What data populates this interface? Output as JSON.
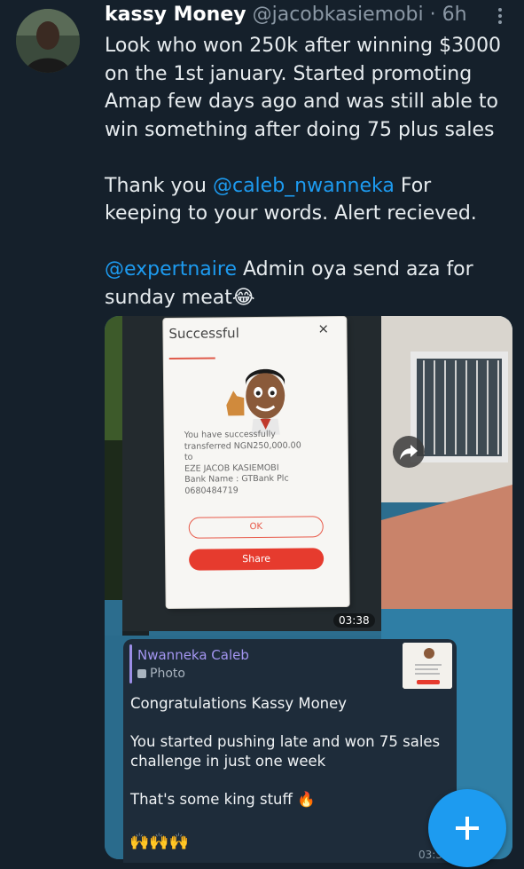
{
  "author": {
    "display_name": "kassy Money",
    "handle": "@jacobkasiemobi",
    "separator": "·",
    "time": "6h"
  },
  "tweet": {
    "paragraph1": "Look who won 250k after winning $3000 on the 1st january. Started promoting Amap few days ago and was still able to win something after doing 75 plus sales",
    "p2_before": "Thank you ",
    "p2_mention": "@caleb_nwanneka",
    "p2_after": " For keeping to your words. Alert recieved.",
    "p3_mention": "@expertnaire",
    "p3_after": " Admin oya send aza for sunday meat😂"
  },
  "media": {
    "photo_time": "03:38",
    "dialog": {
      "title": "Successful",
      "close": "×",
      "line1": "You have successfully",
      "line2": "transferred NGN250,000.00",
      "line3": "to",
      "line4": "EZE JACOB KASIEMOBI",
      "line5": "Bank Name : GTBank Plc",
      "line6": "0680484719",
      "ok_label": "OK",
      "share_label": "Share"
    },
    "message": {
      "reply_author": "Nwanneka Caleb",
      "reply_type": "Photo",
      "para1": "Congratulations Kassy Money",
      "para2": "You started pushing late and won 75 sales challenge in just one week",
      "para3": "That's some king stuff 🔥",
      "emoji_row": "🙌🙌🙌",
      "time": "03:3"
    }
  },
  "colors": {
    "background": "#15202b",
    "link": "#1d9bf0",
    "fab": "#1d9bf0",
    "dialog_button": "#e63b2e"
  }
}
